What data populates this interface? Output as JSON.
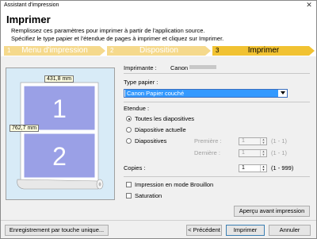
{
  "window": {
    "title": "Assistant d'impression",
    "close": "✕"
  },
  "header": {
    "title": "Imprimer",
    "line1": "Remplissez ces paramètres pour imprimer à partir de l'application source.",
    "line2": "Spécifiez le type papier et l'étendue de pages à imprimer et cliquez sur Imprimer."
  },
  "steps": [
    {
      "num": "1",
      "label": "Menu d'impression",
      "active": false
    },
    {
      "num": "2",
      "label": "Disposition",
      "active": false
    },
    {
      "num": "3",
      "label": "Imprimer",
      "active": true
    }
  ],
  "preview": {
    "width_label": "431,8 mm",
    "height_label": "762,7 mm",
    "pages": [
      "1",
      "2"
    ]
  },
  "form": {
    "printer_label": "Imprimante :",
    "printer_value": "Canon",
    "paper_label": "Type papier :",
    "paper_value": "Canon Papier couché",
    "range_label": "Etendue :",
    "opt_all": "Toutes les diapositives",
    "opt_current": "Diapositive actuelle",
    "opt_range": "Diapositives",
    "first_label": "Première :",
    "last_label": "Dernière :",
    "first_value": "1",
    "last_value": "1",
    "first_hint": "(1 - 1)",
    "last_hint": "(1 - 1)",
    "copies_label": "Copies :",
    "copies_value": "1",
    "copies_hint": "(1 - 999)",
    "draft_label": "Impression en mode Brouillon",
    "saturation_label": "Saturation",
    "preview_button": "Aperçu avant impression"
  },
  "footer": {
    "register_button": "Enregistrement par touche unique...",
    "prev_button": "< Précédent",
    "print_button": "Imprimer",
    "cancel_button": "Annuler"
  },
  "colors": {
    "step_inactive": "#f5d98c",
    "step_active": "#f1c232",
    "selection": "#3399ff",
    "preview_bg": "#d8ebf7",
    "page_fill": "#9aa0e6"
  }
}
